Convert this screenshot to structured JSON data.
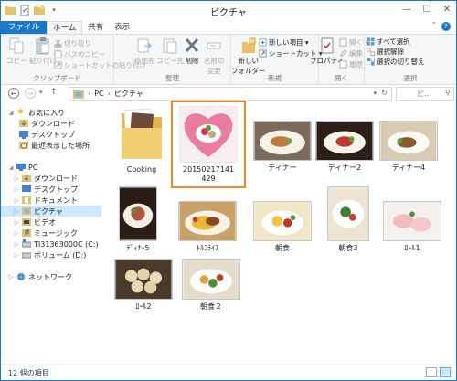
{
  "window": {
    "title": "ピクチャ"
  },
  "tabs": [
    {
      "label": "ファイル"
    },
    {
      "label": "ホーム"
    },
    {
      "label": "共有"
    },
    {
      "label": "表示"
    }
  ],
  "ribbon": {
    "clipboard": {
      "group_label": "クリップボード",
      "copy": "コピー",
      "paste": "貼り付け",
      "cut": "切り取り",
      "copy_path": "パスのコピー",
      "paste_shortcut": "ショートカットの貼り付け"
    },
    "organize": {
      "group_label": "整理",
      "move_to": "移動先",
      "copy_to": "コピー先",
      "delete": "削除",
      "rename_1": "名前の",
      "rename_2": "変更"
    },
    "new": {
      "group_label": "新規",
      "new_folder_1": "新しい",
      "new_folder_2": "フォルダー",
      "new_item": "新しい項目 ▾",
      "shortcut": "ショートカット ▾"
    },
    "open": {
      "group_label": "開く",
      "properties": "プロパティ",
      "open": "開く ▾",
      "edit": "編集",
      "history": "履歴"
    },
    "select": {
      "group_label": "選択",
      "select_all": "すべて選択",
      "select_none": "選択解除",
      "invert": "選択の切り替え"
    }
  },
  "address": {
    "path": [
      "PC",
      "ピクチャ"
    ],
    "search_placeholder": "ピ..."
  },
  "nav": {
    "favorites": "お気に入り",
    "downloads": "ダウンロード",
    "desktop": "デスクトップ",
    "recent": "最近表示した場所",
    "pc": "PC",
    "pc_downloads": "ダウンロード",
    "pc_desktop": "デスクトップ",
    "documents": "ドキュメント",
    "pictures": "ピクチャ",
    "videos": "ビデオ",
    "music": "ミュージック",
    "drive_c": "TI31363000C (C:)",
    "drive_d": "ボリューム (D:)",
    "network": "ネットワーク"
  },
  "items": [
    {
      "label": "Cooking"
    },
    {
      "label": "20150217141429"
    },
    {
      "label": "ディナー"
    },
    {
      "label": "ディナー2"
    },
    {
      "label": "ディナー4"
    },
    {
      "label": "ﾃﾞｨﾅｰ5"
    },
    {
      "label": "ﾄﾙｺﾗｲｽ"
    },
    {
      "label": "朝食"
    },
    {
      "label": "朝食3"
    },
    {
      "label": "ﾛｰﾙ1"
    },
    {
      "label": "ﾛｰﾙ2"
    },
    {
      "label": "朝食２"
    }
  ],
  "status": {
    "count": "12 個の項目"
  },
  "colors": {
    "accent": "#1979ca",
    "selection": "#f08a1c",
    "nav_selected": "#cce8ff"
  }
}
